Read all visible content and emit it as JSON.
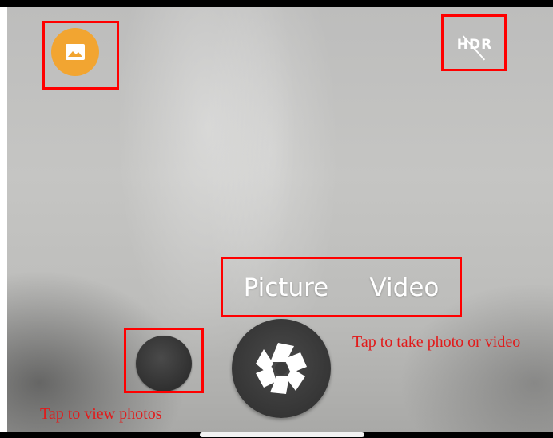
{
  "camera": {
    "gallery_icon": "image-icon",
    "hdr_icon": "hdr-off-icon",
    "hdr_label": "HDR",
    "modes": [
      "Picture",
      "Video"
    ],
    "shutter_icon": "aperture-icon",
    "accent_color": "#f2a531"
  },
  "annotations": {
    "take_photo": "Tap to take photo or video",
    "view_photos": "Tap to view photos",
    "highlight_color": "#ff0000"
  }
}
